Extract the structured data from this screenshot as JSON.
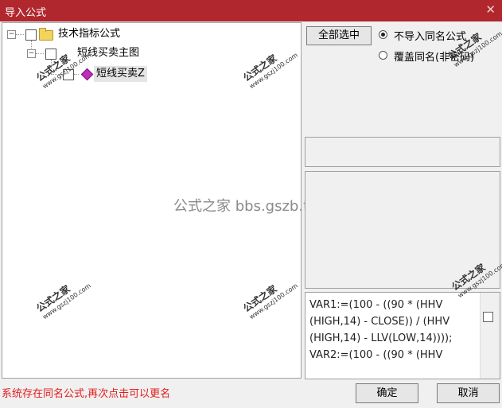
{
  "window": {
    "title": "导入公式",
    "close_glyph": "✕"
  },
  "tree": {
    "root": {
      "label": "技术指标公式",
      "expander": "−"
    },
    "child": {
      "label": "短线买卖主图",
      "expander": "−"
    },
    "leaf": {
      "label": "短线买卖Z"
    }
  },
  "watermark": {
    "text": "公式之家",
    "site": "www.gszj100.com",
    "center": "公式之家 bbs.gszb.top"
  },
  "options": {
    "select_all_label": "全部选中",
    "radio_skip_label": "不导入同名公式",
    "radio_overwrite_label": "覆盖同名(非密码)"
  },
  "code": {
    "lines": [
      "VAR1:=(100 - ((90 * (HHV",
      "(HIGH,14) - CLOSE)) / (HHV",
      "(HIGH,14) - LLV(LOW,14))));",
      "VAR2:=(100 - ((90 * (HHV"
    ]
  },
  "footer": {
    "status": "系统存在同名公式,再次点击可以更名",
    "ok_label": "确定",
    "cancel_label": "取消"
  },
  "colors": {
    "titlebar": "#b0272d",
    "status_text": "#e31c1c"
  }
}
